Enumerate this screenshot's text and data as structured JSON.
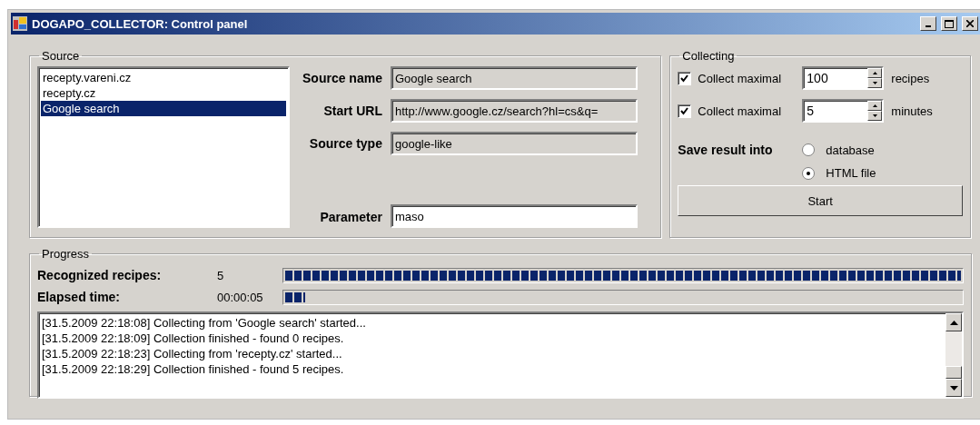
{
  "window": {
    "title": "DOGAPO_COLLECTOR: Control panel"
  },
  "source": {
    "title": "Source",
    "items": [
      {
        "label": "recepty.vareni.cz",
        "selected": false
      },
      {
        "label": "recepty.cz",
        "selected": false
      },
      {
        "label": "Google search",
        "selected": true
      }
    ],
    "fields": [
      {
        "label": "Source name",
        "value": "Google search",
        "readonly": true
      },
      {
        "label": "Start URL",
        "value": "http://www.google.cz/search?hl=cs&q=",
        "readonly": true
      },
      {
        "label": "Source type",
        "value": "google-like",
        "readonly": true
      },
      {
        "label": "Parameter",
        "value": "maso",
        "readonly": false
      }
    ]
  },
  "collecting": {
    "title": "Collecting",
    "limits": [
      {
        "label": "Collect maximal",
        "checked": true,
        "value": "100",
        "unit": "recipes"
      },
      {
        "label": "Collect maximal",
        "checked": true,
        "value": "5",
        "unit": "minutes"
      }
    ],
    "save_label": "Save result into",
    "save_options": [
      {
        "label": "database",
        "selected": false
      },
      {
        "label": "HTML file",
        "selected": true
      }
    ],
    "start_button": "Start"
  },
  "progress": {
    "title": "Progress",
    "meters": [
      {
        "label": "Recognized recipes:",
        "reading": "5",
        "level": 1.0
      },
      {
        "label": "Elapsed time:",
        "reading": "00:00:05",
        "level": 0.03
      }
    ],
    "log": [
      "[31.5.2009 22:18:08] Collecting from 'Google search' started...",
      "[31.5.2009 22:18:09] Collection finished - found 0 recipes.",
      "[31.5.2009 22:18:23] Collecting from 'recepty.cz' started...",
      "[31.5.2009 22:18:29] Collection finished - found 5 recipes."
    ]
  }
}
